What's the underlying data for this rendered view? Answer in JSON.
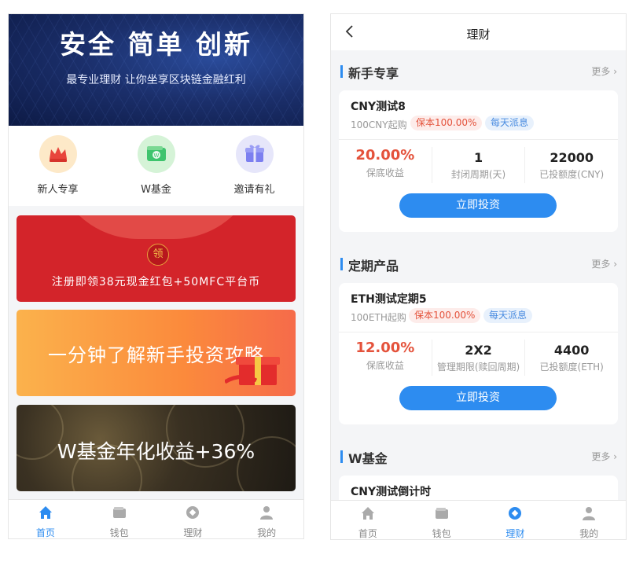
{
  "left": {
    "hero": {
      "title": "安全 简单 创新",
      "subtitle": "最专业理财 让你坐享区块链金融红利"
    },
    "quick": [
      {
        "label": "新人专享",
        "icon": "crown-icon"
      },
      {
        "label": "W基金",
        "icon": "wallet-w-icon"
      },
      {
        "label": "邀请有礼",
        "icon": "gift-icon"
      }
    ],
    "banners": {
      "red": {
        "badge": "领",
        "text": "注册即领38元现金红包+50MFC平台币"
      },
      "orange": {
        "text": "一分钟了解新手投资攻略"
      },
      "dark": {
        "text": "W基金年化收益+36%"
      }
    },
    "tabbar": [
      {
        "label": "首页",
        "icon": "home-icon",
        "active": true
      },
      {
        "label": "钱包",
        "icon": "wallet-icon",
        "active": false
      },
      {
        "label": "理财",
        "icon": "finance-icon",
        "active": false
      },
      {
        "label": "我的",
        "icon": "user-icon",
        "active": false
      }
    ]
  },
  "right": {
    "navbar": {
      "title": "理财"
    },
    "sections": [
      {
        "title": "新手专享",
        "more": "更多",
        "product": {
          "name": "CNY测试8",
          "start": "100CNY起购",
          "tag1": "保本100.00%",
          "tag2": "每天派息",
          "stats": [
            {
              "value": "20.00%",
              "label": "保底收益"
            },
            {
              "value": "1",
              "label": "封闭周期(天)"
            },
            {
              "value": "22000",
              "label": "已投额度(CNY)"
            }
          ],
          "button": "立即投资"
        }
      },
      {
        "title": "定期产品",
        "more": "更多",
        "product": {
          "name": "ETH测试定期5",
          "start": "100ETH起购",
          "tag1": "保本100.00%",
          "tag2": "每天派息",
          "stats": [
            {
              "value": "12.00%",
              "label": "保底收益"
            },
            {
              "value": "2X2",
              "label": "管理期限(赎回周期)"
            },
            {
              "value": "4400",
              "label": "已投额度(ETH)"
            }
          ],
          "button": "立即投资"
        }
      },
      {
        "title": "W基金",
        "more": "更多",
        "product": {
          "name": "CNY测试倒计时"
        }
      }
    ],
    "tabbar": [
      {
        "label": "首页",
        "icon": "home-icon",
        "active": false
      },
      {
        "label": "钱包",
        "icon": "wallet-icon",
        "active": false
      },
      {
        "label": "理财",
        "icon": "finance-icon",
        "active": true
      },
      {
        "label": "我的",
        "icon": "user-icon",
        "active": false
      }
    ]
  },
  "colors": {
    "accent": "#2d8cf0",
    "rate": "#e4523b",
    "banner_red": "#d3242a"
  }
}
